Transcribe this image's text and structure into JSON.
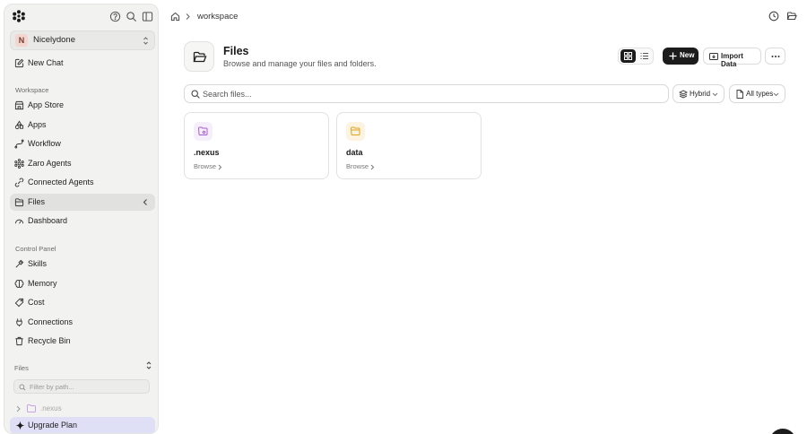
{
  "sidebar": {
    "workspace": {
      "initial": "N",
      "name": "Nicelydone"
    },
    "new_chat": "New Chat",
    "section_workspace": "Workspace",
    "workspace_items": [
      {
        "label": "App Store",
        "icon": "store-icon"
      },
      {
        "label": "Apps",
        "icon": "apps-icon"
      },
      {
        "label": "Workflow",
        "icon": "workflow-icon"
      },
      {
        "label": "Zaro Agents",
        "icon": "agents-icon"
      },
      {
        "label": "Connected Agents",
        "icon": "connected-agents-icon"
      },
      {
        "label": "Files",
        "icon": "folder-icon",
        "active": true
      },
      {
        "label": "Dashboard",
        "icon": "dashboard-icon"
      }
    ],
    "section_control": "Control Panel",
    "control_items": [
      {
        "label": "Skills",
        "icon": "skills-icon"
      },
      {
        "label": "Memory",
        "icon": "memory-icon"
      },
      {
        "label": "Cost",
        "icon": "cost-icon"
      },
      {
        "label": "Connections",
        "icon": "connections-icon"
      },
      {
        "label": "Recycle Bin",
        "icon": "trash-icon"
      }
    ],
    "section_files": "Files",
    "filter_placeholder": "Filter by path...",
    "tree": [
      {
        "label": ".nexus"
      }
    ],
    "upgrade": "Upgrade Plan"
  },
  "breadcrumb": {
    "current": "workspace"
  },
  "header": {
    "title": "Files",
    "subtitle": "Browse and manage your files and folders."
  },
  "toolbar": {
    "new_label": "New",
    "import_label": "Import Data"
  },
  "search": {
    "placeholder": "Search files..."
  },
  "filters": {
    "mode": "Hybrid",
    "types": "All types"
  },
  "folders": [
    {
      "name": ".nexus",
      "action": "Browse",
      "color": "#a95cd6",
      "bg": "#f5eefb"
    },
    {
      "name": "data",
      "action": "Browse",
      "color": "#e0a21b",
      "bg": "#fcf3e1"
    }
  ],
  "colors": {
    "accent": "#1c1c1c",
    "active_nav": "#e1e1df",
    "upgrade_bg": "#dfdff6"
  }
}
